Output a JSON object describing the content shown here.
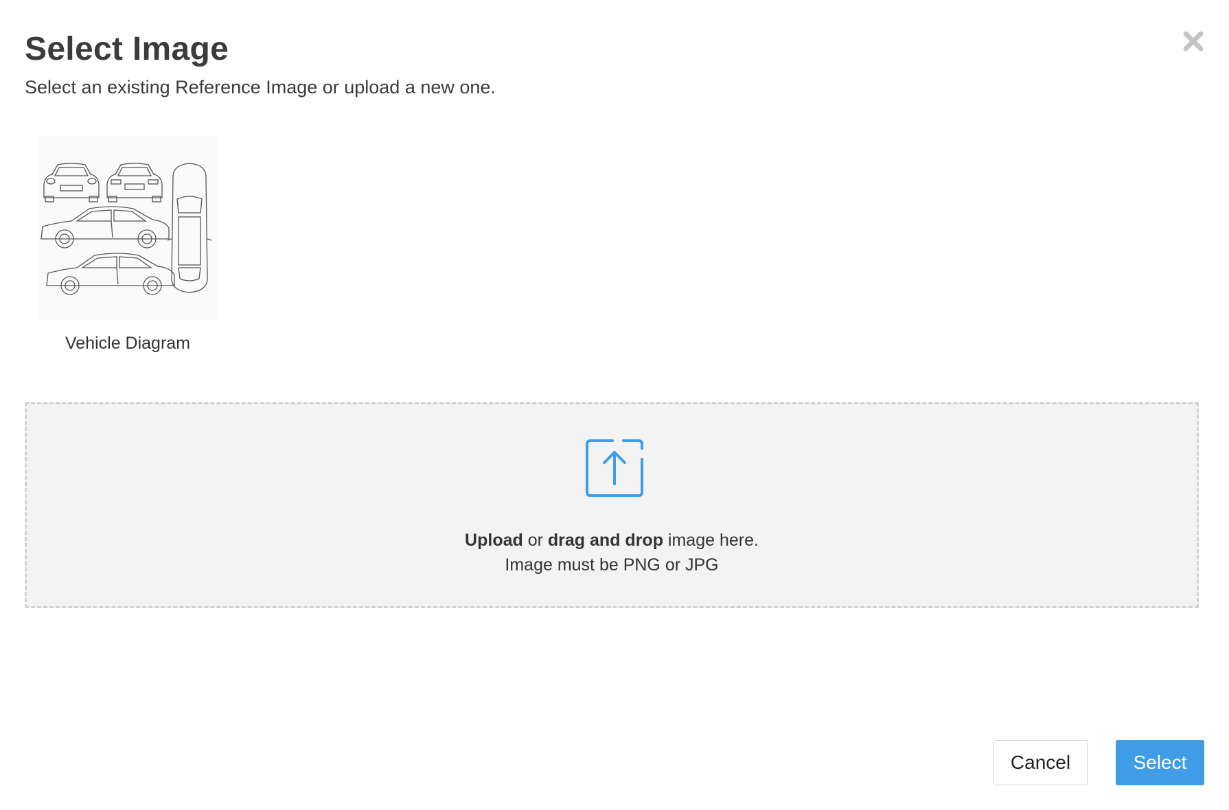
{
  "dialog": {
    "title": "Select Image",
    "subtitle": "Select an existing Reference Image or upload a new one.",
    "close_icon": "close-icon"
  },
  "images": [
    {
      "label": "Vehicle Diagram",
      "icon": "vehicle-diagram-thumbnail"
    }
  ],
  "dropzone": {
    "icon": "upload-icon",
    "upload_word": "Upload",
    "or_word": "or",
    "drag_phrase": "drag and drop",
    "rest": "image here.",
    "requirement": "Image must be PNG or JPG"
  },
  "buttons": {
    "cancel_label": "Cancel",
    "select_label": "Select"
  },
  "colors": {
    "accent": "#3e9de6",
    "dropzone_bg": "#f3f3f3",
    "dropzone_border": "#d2d2d2"
  }
}
